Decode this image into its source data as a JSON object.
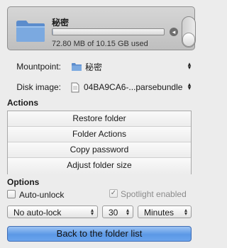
{
  "volume": {
    "name": "秘密",
    "usage_text": "72.80 MB of 10.15 GB used",
    "used_fraction": 0.007,
    "eject_glyph": "◂",
    "mounted": true
  },
  "mountpoint": {
    "label": "Mountpoint:",
    "value": "秘密",
    "icon": "folder-icon"
  },
  "disk_image": {
    "label": "Disk image:",
    "value": "04BA9CA6-...parsebundle",
    "icon": "document-icon"
  },
  "actions": {
    "title": "Actions",
    "items": [
      {
        "label": "Restore folder"
      },
      {
        "label": "Folder Actions"
      },
      {
        "label": "Copy password"
      },
      {
        "label": "Adjust folder size"
      }
    ]
  },
  "options": {
    "title": "Options",
    "auto_unlock": {
      "label": "Auto-unlock",
      "checked": false
    },
    "spotlight": {
      "label": "Spotlight enabled",
      "checked": true,
      "enabled": false
    },
    "auto_lock_mode": "No auto-lock",
    "auto_lock_amount": "30",
    "auto_lock_unit": "Minutes"
  },
  "back_button": {
    "label": "Back to the folder list"
  },
  "colors": {
    "accent": "#5b98e6",
    "folder": "#6e9fd8"
  }
}
